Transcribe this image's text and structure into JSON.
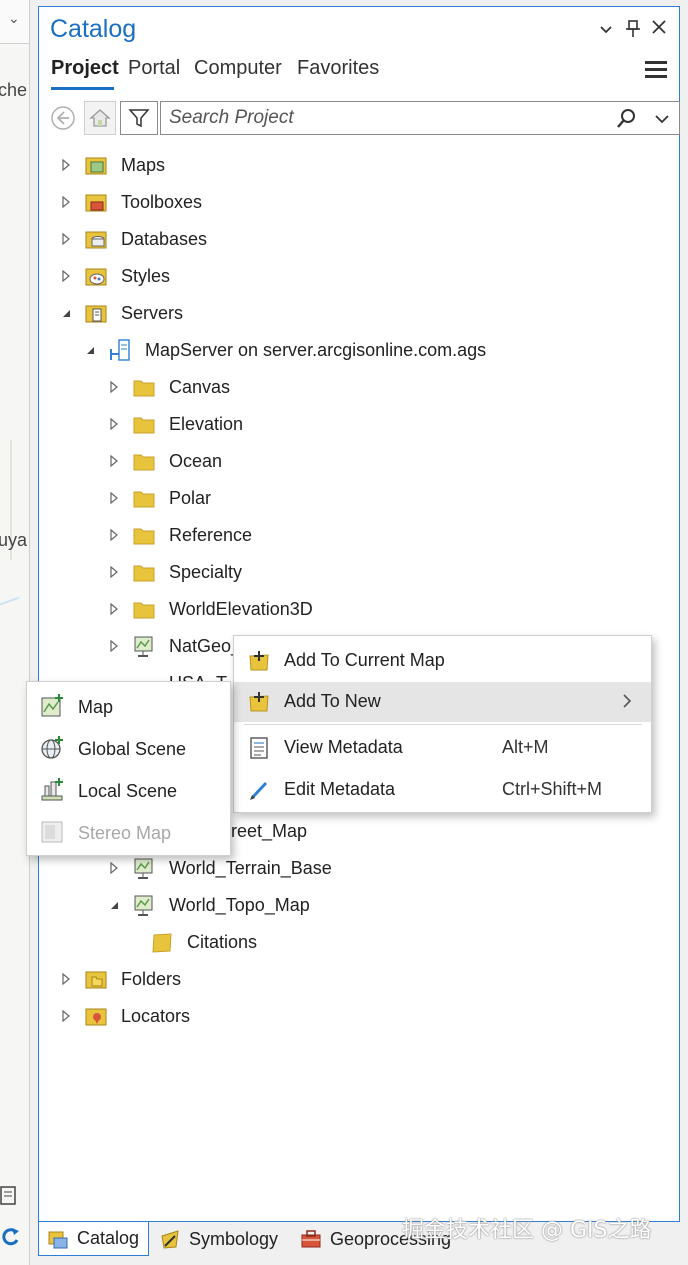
{
  "map_strip": {
    "fragments": [
      "che",
      "uya"
    ]
  },
  "catalog": {
    "title": "Catalog",
    "tabs": [
      {
        "label": "Project",
        "active": true
      },
      {
        "label": "Portal",
        "active": false
      },
      {
        "label": "Computer",
        "active": false
      },
      {
        "label": "Favorites",
        "active": false
      }
    ],
    "search": {
      "placeholder": "Search Project",
      "value": ""
    },
    "tree": [
      {
        "label": "Maps",
        "icon": "maps-folder-icon",
        "expanded": false
      },
      {
        "label": "Toolboxes",
        "icon": "toolboxes-folder-icon",
        "expanded": false
      },
      {
        "label": "Databases",
        "icon": "databases-folder-icon",
        "expanded": false
      },
      {
        "label": "Styles",
        "icon": "styles-folder-icon",
        "expanded": false
      },
      {
        "label": "Servers",
        "icon": "servers-folder-icon",
        "expanded": true
      },
      {
        "label": "MapServer on server.arcgisonline.com.ags",
        "icon": "server-connection-icon",
        "expanded": true
      },
      {
        "label": "Canvas",
        "icon": "folder-icon",
        "expanded": false
      },
      {
        "label": "Elevation",
        "icon": "folder-icon",
        "expanded": false
      },
      {
        "label": "Ocean",
        "icon": "folder-icon",
        "expanded": false
      },
      {
        "label": "Polar",
        "icon": "folder-icon",
        "expanded": false
      },
      {
        "label": "Reference",
        "icon": "folder-icon",
        "expanded": false
      },
      {
        "label": "Specialty",
        "icon": "folder-icon",
        "expanded": false
      },
      {
        "label": "WorldElevation3D",
        "icon": "folder-icon",
        "expanded": false
      },
      {
        "label": "NatGeo_",
        "icon": "map-service-icon",
        "expanded": false
      },
      {
        "label": "USA_T",
        "icon": "map-service-icon",
        "expanded": false
      },
      {
        "label": "reet_Map",
        "icon": "map-service-icon",
        "expanded": false
      },
      {
        "label": "World_Terrain_Base",
        "icon": "map-service-icon",
        "expanded": false
      },
      {
        "label": "World_Topo_Map",
        "icon": "map-service-icon",
        "expanded": true
      },
      {
        "label": "Citations",
        "icon": "citations-icon",
        "expanded": false
      },
      {
        "label": "Folders",
        "icon": "folders-icon",
        "expanded": false
      },
      {
        "label": "Locators",
        "icon": "locators-icon",
        "expanded": false
      }
    ]
  },
  "context_menu": {
    "items": [
      {
        "label": "Add To Current Map",
        "shortcut": ""
      },
      {
        "label": "Add To New",
        "shortcut": ""
      },
      {
        "label": "View Metadata",
        "shortcut": "Alt+M"
      },
      {
        "label": "Edit Metadata",
        "shortcut": "Ctrl+Shift+M"
      }
    ]
  },
  "submenu": {
    "items": [
      {
        "label": "Map",
        "enabled": true
      },
      {
        "label": "Global Scene",
        "enabled": true
      },
      {
        "label": "Local Scene",
        "enabled": true
      },
      {
        "label": "Stereo Map",
        "enabled": false
      }
    ]
  },
  "dock_tabs": [
    {
      "label": "Catalog",
      "active": true
    },
    {
      "label": "Symbology",
      "active": false
    },
    {
      "label": "Geoprocessing",
      "active": false
    }
  ],
  "watermark": "掘金技术社区 @ GIS之路",
  "colors": {
    "accent": "#1a6fc2",
    "folder": "#e8c33c",
    "border": "#2f7fd6"
  }
}
